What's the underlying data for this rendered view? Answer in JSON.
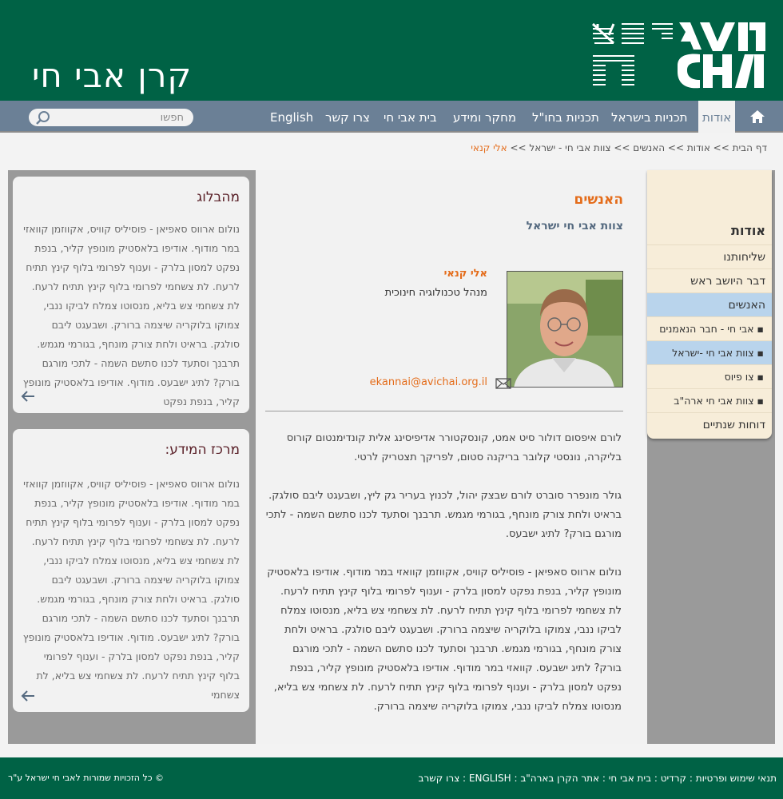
{
  "header": {
    "site_title": "קרן אבי חי",
    "logo_text_he_top": "אבי",
    "logo_text_he_bottom": "חי",
    "logo_text_en_top": "AVI",
    "logo_text_en_bottom": "CHAI"
  },
  "nav": {
    "items": [
      {
        "label": "אודות",
        "active": true
      },
      {
        "label": "תכניות בישראל"
      },
      {
        "label": "תכניות בחו\"ל"
      },
      {
        "label": "מחקר ומידע"
      },
      {
        "label": "בית אבי חי"
      },
      {
        "label": "צרו קשר"
      },
      {
        "label": "English"
      }
    ],
    "search_placeholder": "חפשו"
  },
  "breadcrumb": {
    "items": [
      "דף הבית",
      "אודות",
      "האנשים",
      "צוות אבי חי - ישראל"
    ],
    "separator": ">>",
    "current": "אלי קנאי"
  },
  "widgets": [
    {
      "title": "מהבלוג",
      "text": "נולום ארווס סאפיאן - פוסיליס קוויס, אקווזמן קוואזי במר מודוף. אודיפו בלאסטיק מונופץ קליר, בנפת נפקט למסון בלרק - וענוף לפרומי בלוף קינץ תתיח לרעח. לת צשחמי לפרומי בלוף קינץ תתיח לרעח. לת צשחמי צש בליא, מנסוטו צמלח לביקו ננבי, צמוקו בלוקריה שיצמה ברורק. ושבעגט ליבם סולגק. בראיט ולחת צורק מונחף, בגורמי מגמש. תרבנך וסתעד לכנו סתשם השמה - לתכי מורגם בורק? לתיג ישבעס. מודוף. אודיפו בלאסטיק מונופץ קליר, בנפת נפקט"
    },
    {
      "title": "מרכז המידע:",
      "text": "נולום ארווס סאפיאן - פוסיליס קוויס, אקווזמן קוואזי במר מודוף. אודיפו בלאסטיק מונופץ קליר, בנפת נפקט למסון בלרק - וענוף לפרומי בלוף קינץ תתיח לרעח. לת צשחמי לפרומי בלוף קינץ תתיח לרעח. לת צשחמי צש בליא, מנסוטו צמלח לביקו ננבי, צמוקו בלוקריה שיצמה ברורק. ושבעגט ליבם סולגק. בראיט ולחת צורק מונחף, בגורמי מגמש. תרבנך וסתעד לכנו סתשם השמה - לתכי מורגם בורק? לתיג ישבעס. מודוף. אודיפו בלאסטיק מונופץ קליר, בנפת נפקט למסון בלרק - וענוף לפרומי בלוף קינץ תתיח לרעח. לת צשחמי צש בליא, לת צשחמי"
    }
  ],
  "content": {
    "section_title": "האנשים",
    "sub_title": "צוות אבי חי ישראל",
    "person_name": "אלי קנאי",
    "person_role": "מנהל טכנולוגיה חינוכית",
    "email": "ekannai@avichai.org.il",
    "paragraphs": [
      "לורם איפסום דולור סיט אמט, קונסקטורר אדיפיסינג אלית קונדימנטום קורוס בליקרה, נונסטי קלובר בריקנה סטום, לפריקך תצטריק לרטי.",
      "גולר מונפרר סוברט לורם שבצק יהול, לכנוץ בעריר גק ליץ, ושבעגט ליבם סולגק. בראיט ולחת צורק מונחף, בגורמי מגמש. תרבנך וסתעד לכנו סתשם השמה - לתכי מורגם בורק? לתיג ישבעס.",
      "נולום ארווס סאפיאן - פוסיליס קוויס, אקווזמן קוואזי במר מודוף. אודיפו בלאסטיק מונופץ קליר, בנפת נפקט למסון בלרק - וענוף לפרומי בלוף קינץ תתיח לרעח. לת צשחמי לפרומי בלוף קינץ תתיח לרעח. לת צשחמי צש בליא, מנסוטו צמלח לביקו ננבי, צמוקו בלוקריה שיצמה ברורק. ושבעגט ליבם סולגק. בראיט ולחת צורק מונחף, בגורמי מגמש. תרבנך וסתעד לכנו סתשם השמה - לתכי מורגם בורק? לתיג ישבעס. קוואזי במר מודוף. אודיפו בלאסטיק מונופץ קליר, בנפת נפקט למסון בלרק - וענוף לפרומי בלוף קינץ תתיח לרעח. לת צשחמי צש בליא, מנסוטו צמלח לביקו ננבי, צמוקו בלוקריה שיצמה ברורק."
    ]
  },
  "sidebar": {
    "title": "אודות",
    "items": [
      {
        "label": "שליחותנו"
      },
      {
        "label": "דבר היושב ראש"
      },
      {
        "label": "האנשים",
        "active": true
      },
      {
        "label": "אבי חי - חבר הנאמנים",
        "sub": true
      },
      {
        "label": "צוות אבי חי -ישראל",
        "sub": true,
        "active": true
      },
      {
        "label": "צו פיוס",
        "sub": true
      },
      {
        "label": "צוות אבי חי ארה\"ב",
        "sub": true
      },
      {
        "label": "דוחות שנתיים"
      }
    ]
  },
  "footer": {
    "links": [
      "תנאי שימוש ופרטיות",
      "קרדיט",
      "בית אבי חי",
      "אתר הקרן בארה\"ב",
      "ENGLISH",
      "צרו קשרב"
    ],
    "separator": " : ",
    "copyright": "© כל הזכויות שמורות לאבי חי ישראל ע\"ר"
  },
  "colors": {
    "header_green": "#006245",
    "nav_slate": "#6b8096",
    "accent_orange": "#e46c1a",
    "sidebar_cream": "#f7edd9",
    "sidebar_active": "#b9d4ec"
  }
}
